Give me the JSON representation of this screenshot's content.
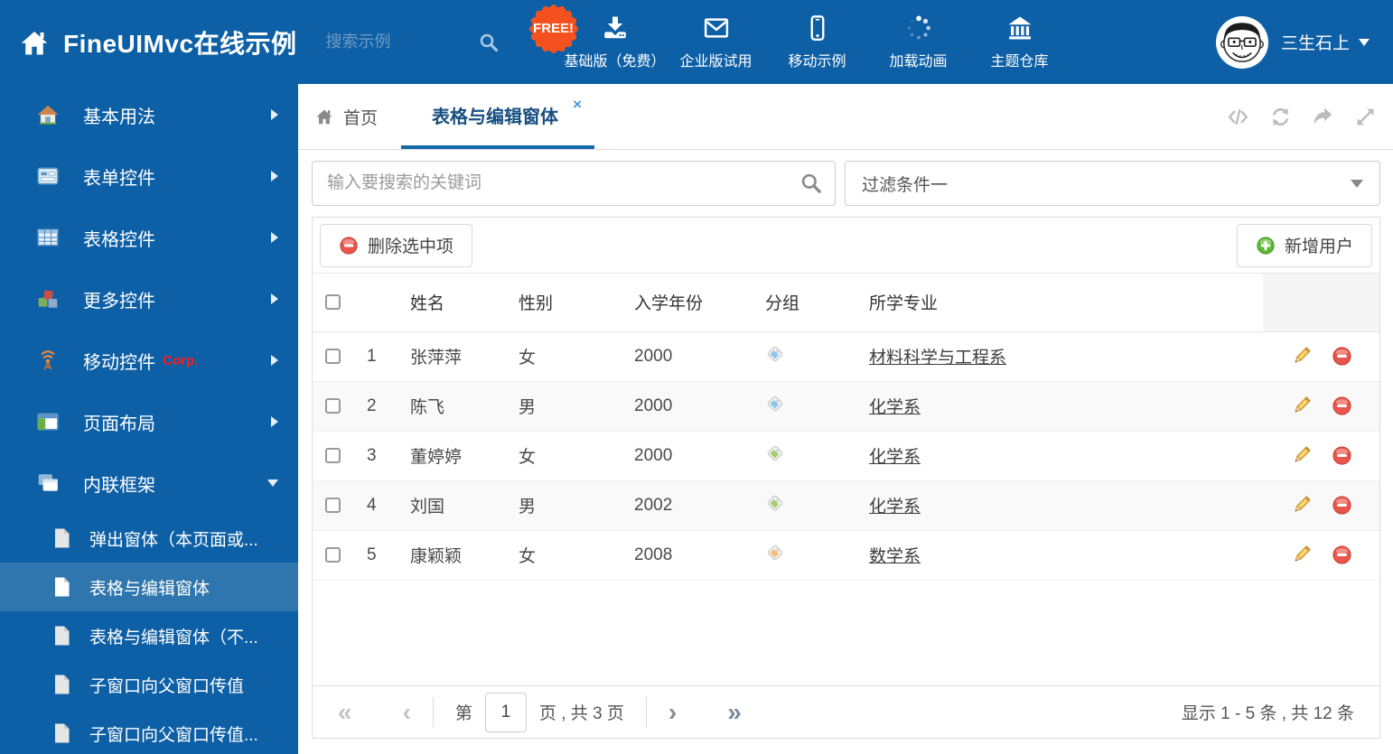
{
  "colors": {
    "header_blue": "#0d5fa6",
    "submenu_active_blue": "#2e76ad",
    "tab_underline_blue": "#1268a8",
    "free_badge_orange": "#f4511e",
    "delete_red": "#e2493f",
    "add_green": "#5eb832"
  },
  "header": {
    "title": "FineUIMvc在线示例",
    "search_placeholder": "搜索示例",
    "free_badge": "FREE!",
    "nav": [
      {
        "label": "基础版（免费）",
        "icon": "download-icon"
      },
      {
        "label": "企业版试用",
        "icon": "envelope-icon"
      },
      {
        "label": "移动示例",
        "icon": "mobile-icon"
      },
      {
        "label": "加载动画",
        "icon": "spinner-icon"
      },
      {
        "label": "主题仓库",
        "icon": "bank-icon"
      }
    ],
    "user": {
      "name": "三生石上"
    }
  },
  "sidebar": {
    "items": [
      {
        "label": "基本用法"
      },
      {
        "label": "表单控件"
      },
      {
        "label": "表格控件"
      },
      {
        "label": "更多控件"
      },
      {
        "label": "移动控件",
        "badge": "Corp."
      },
      {
        "label": "页面布局"
      },
      {
        "label": "内联框架"
      }
    ],
    "subitems": [
      {
        "label": "弹出窗体（本页面或..."
      },
      {
        "label": "表格与编辑窗体"
      },
      {
        "label": "表格与编辑窗体（不..."
      },
      {
        "label": "子窗口向父窗口传值"
      },
      {
        "label": "子窗口向父窗口传值..."
      }
    ]
  },
  "tabs": [
    {
      "label": "首页"
    },
    {
      "label": "表格与编辑窗体"
    }
  ],
  "filter": {
    "search_placeholder": "输入要搜索的关键词",
    "dropdown_value": "过滤条件一"
  },
  "grid": {
    "delete_button": "删除选中项",
    "add_button": "新增用户",
    "columns": {
      "name": "姓名",
      "gender": "性别",
      "year": "入学年份",
      "group": "分组",
      "major": "所学专业"
    },
    "rows": [
      {
        "num": "1",
        "name": "张萍萍",
        "gender": "女",
        "year": "2000",
        "tag_color": "#8dc7f0",
        "major": "材料科学与工程系"
      },
      {
        "num": "2",
        "name": "陈飞",
        "gender": "男",
        "year": "2000",
        "tag_color": "#8dc7f0",
        "major": "化学系"
      },
      {
        "num": "3",
        "name": "董婷婷",
        "gender": "女",
        "year": "2000",
        "tag_color": "#a5cf6f",
        "major": "化学系"
      },
      {
        "num": "4",
        "name": "刘国",
        "gender": "男",
        "year": "2002",
        "tag_color": "#a5cf6f",
        "major": "化学系"
      },
      {
        "num": "5",
        "name": "康颖颖",
        "gender": "女",
        "year": "2008",
        "tag_color": "#f7bd79",
        "major": "数学系"
      }
    ]
  },
  "pagination": {
    "first_icon": "«",
    "prev_icon": "‹",
    "next_icon": "›",
    "last_icon": "»",
    "page_prefix": "第",
    "page_value": "1",
    "page_suffix": "页 , 共 3 页",
    "summary": "显示 1 - 5 条 , 共 12 条"
  }
}
